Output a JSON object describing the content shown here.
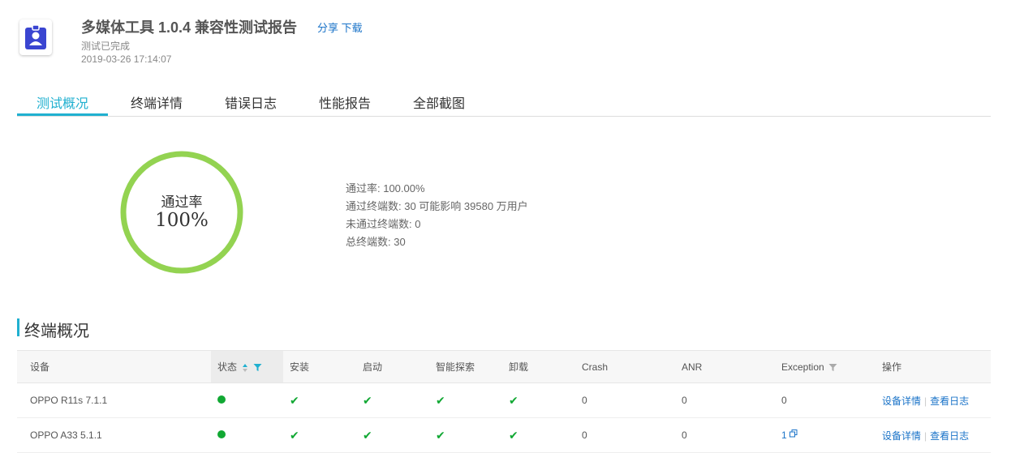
{
  "header": {
    "title": "多媒体工具 1.0.4 兼容性测试报告",
    "share_label": "分享",
    "download_label": "下载",
    "status": "测试已完成",
    "timestamp": "2019-03-26 17:14:07",
    "app_icon": "badge-user-icon"
  },
  "tabs": [
    {
      "label": "测试概况",
      "active": true
    },
    {
      "label": "终端详情",
      "active": false
    },
    {
      "label": "错误日志",
      "active": false
    },
    {
      "label": "性能报告",
      "active": false
    },
    {
      "label": "全部截图",
      "active": false
    }
  ],
  "summary": {
    "ring_label": "通过率",
    "ring_value": "100%",
    "pass_rate_fraction": 1.0,
    "stats": [
      "通过率: 100.00%",
      "通过终端数: 30 可能影响 39580 万用户",
      "未通过终端数: 0",
      "总终端数: 30"
    ]
  },
  "section": {
    "title": "终端概况"
  },
  "table": {
    "columns": [
      "设备",
      "状态",
      "安装",
      "启动",
      "智能探索",
      "卸载",
      "Crash",
      "ANR",
      "Exception",
      "操作"
    ],
    "rows": [
      {
        "device": "OPPO R11s 7.1.1",
        "crash": "0",
        "anr": "0",
        "exception": "0",
        "detail_label": "设备详情",
        "log_label": "查看日志"
      },
      {
        "device": "OPPO A33 5.1.1",
        "crash": "0",
        "anr": "0",
        "exception": "1",
        "detail_label": "设备详情",
        "log_label": "查看日志"
      }
    ]
  },
  "colors": {
    "accent": "#20b0d0",
    "ring": "#93d351",
    "success": "#11a833",
    "link": "#1a73c8",
    "icon_blue": "#3a45d1"
  }
}
